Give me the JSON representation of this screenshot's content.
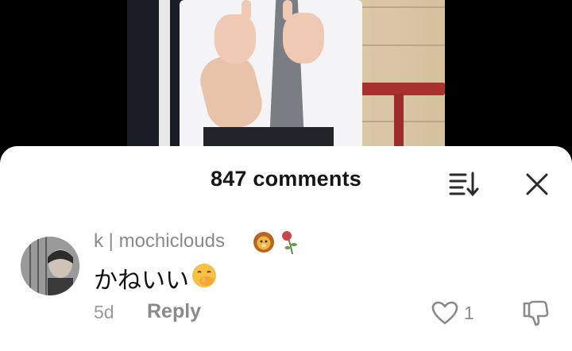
{
  "video": {
    "description": "Screenshot of video frame"
  },
  "sheet": {
    "title": "847 comments",
    "sort_icon": "sort-icon",
    "close_icon": "close-icon"
  },
  "comment": {
    "username": "k | mochiclouds",
    "username_emojis": [
      "lion-emoji",
      "wilted-rose-emoji"
    ],
    "text": "かねいい",
    "text_emoji": "hand-over-mouth-emoji",
    "time": "5d",
    "reply_label": "Reply",
    "like_count": "1",
    "like_icon": "heart-icon",
    "dislike_icon": "thumbs-down-icon"
  },
  "colors": {
    "background": "#000000",
    "sheet": "#ffffff",
    "title": "#161616",
    "muted": "#8a8a8a"
  }
}
